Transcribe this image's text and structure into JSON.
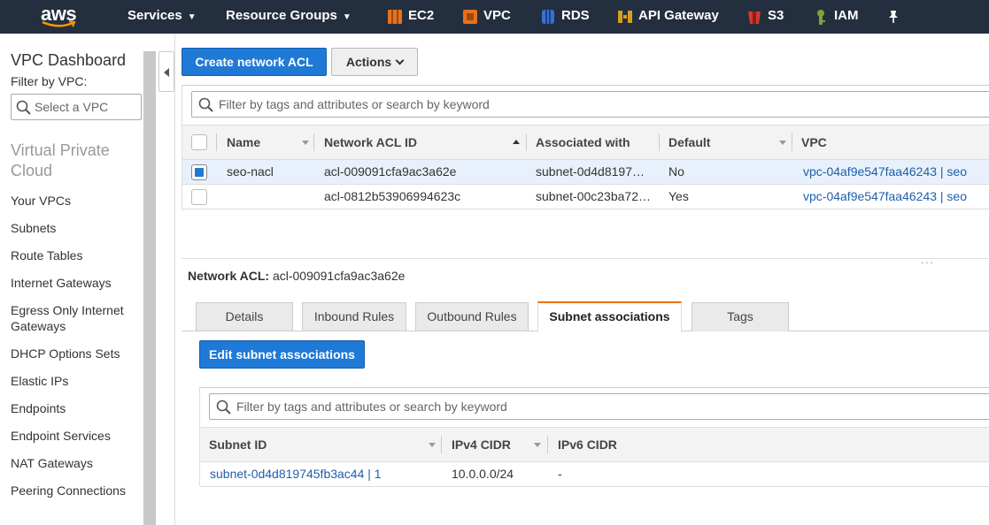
{
  "nav": {
    "logo_text": "aws",
    "services_label": "Services",
    "resource_groups_label": "Resource Groups",
    "services": [
      {
        "label": "EC2",
        "color": "#e8711b",
        "icon": "ec2-icon"
      },
      {
        "label": "VPC",
        "color": "#e8711b",
        "icon": "vpc-icon"
      },
      {
        "label": "RDS",
        "color": "#3b6fd1",
        "icon": "rds-icon"
      },
      {
        "label": "API Gateway",
        "color": "#d69f23",
        "icon": "api-gateway-icon"
      },
      {
        "label": "S3",
        "color": "#d13b2e",
        "icon": "s3-icon"
      },
      {
        "label": "IAM",
        "color": "#7aa33c",
        "icon": "iam-icon"
      }
    ],
    "pin_icon": "pin-icon"
  },
  "sidebar": {
    "title": "VPC Dashboard",
    "filter_label": "Filter by VPC:",
    "select_placeholder": "Select a VPC",
    "section_title": "Virtual Private Cloud",
    "items": [
      "Your VPCs",
      "Subnets",
      "Route Tables",
      "Internet Gateways",
      "Egress Only Internet Gateways",
      "DHCP Options Sets",
      "Elastic IPs",
      "Endpoints",
      "Endpoint Services",
      "NAT Gateways",
      "Peering Connections"
    ]
  },
  "toolbar": {
    "create_label": "Create network ACL",
    "actions_label": "Actions"
  },
  "acl_table": {
    "filter_placeholder": "Filter by tags and attributes or search by keyword",
    "columns": {
      "name": "Name",
      "acl_id": "Network ACL ID",
      "associated": "Associated with",
      "default": "Default",
      "vpc": "VPC"
    },
    "rows": [
      {
        "selected": true,
        "name": "seo-nacl",
        "acl_id": "acl-009091cfa9ac3a62e",
        "associated": "subnet-0d4d8197…",
        "default": "No",
        "vpc": "vpc-04af9e547faa46243 | seo"
      },
      {
        "selected": false,
        "name": "",
        "acl_id": "acl-0812b53906994623c",
        "associated": "subnet-00c23ba72…",
        "default": "Yes",
        "vpc": "vpc-04af9e547faa46243 | seo"
      }
    ]
  },
  "detail": {
    "label": "Network ACL:",
    "value": "acl-009091cfa9ac3a62e",
    "tabs": [
      "Details",
      "Inbound Rules",
      "Outbound Rules",
      "Subnet associations",
      "Tags"
    ],
    "active_tab": "Subnet associations",
    "edit_label": "Edit subnet associations"
  },
  "subnet_table": {
    "filter_placeholder": "Filter by tags and attributes or search by keyword",
    "columns": {
      "subnet_id": "Subnet ID",
      "ipv4": "IPv4 CIDR",
      "ipv6": "IPv6 CIDR"
    },
    "rows": [
      {
        "subnet_id": "subnet-0d4d819745fb3ac44 | 1",
        "ipv4": "10.0.0.0/24",
        "ipv6": "-"
      }
    ]
  }
}
